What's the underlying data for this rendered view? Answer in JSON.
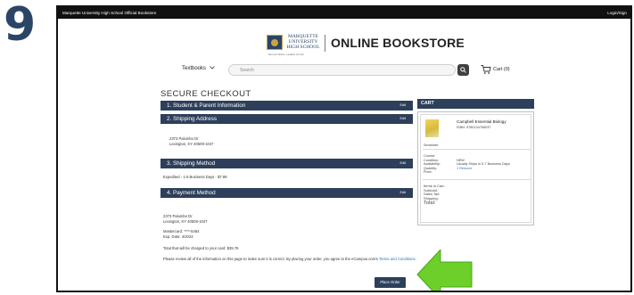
{
  "step_number": "9",
  "topbar": {
    "site_name": "Marquette University High School Official Bookstore",
    "login": "Login/Sign"
  },
  "brand": {
    "logo_line1": "MARQUETTE",
    "logo_line2": "UNIVERSITY",
    "logo_line3": "HIGH SCHOOL",
    "tagline": "Men for Others, Leaders for Life",
    "title": "ONLINE BOOKSTORE"
  },
  "nav": {
    "textbooks": "Textbooks",
    "search_placeholder": "Search",
    "cart": "Cart (0)"
  },
  "checkout": {
    "title": "SECURE CHECKOUT",
    "edit_label": "Edit",
    "sections": {
      "student": "1. Student & Parent Information",
      "shipping_address": "2. Shipping Address",
      "shipping_method": "3. Shipping Method",
      "payment": "4. Payment Method"
    },
    "address_line1": "2373 Palumbo Dr",
    "address_line2": "Lexington, KY 40509-1047",
    "shipping_method_value": "Expedited - 1-5 Business Days - $7.99",
    "billing_line1": "2373 Palumbo Dr",
    "billing_line2": "Lexington, KY 40509-1047",
    "card": "Mastercard: ****-5454",
    "exp": "Exp. Date: 4/2024",
    "total_charged": "Total that will be charged to your card: $35.76",
    "notice_part1": "Please review all of the information on this page to make sure it is correct. By placing your order, you agree to the",
    "notice_part2": "eCampus.com's",
    "terms_link": "Terms and Conditions",
    "place_order": "Place Order"
  },
  "cart": {
    "title": "CART",
    "book_title": "Campbell Essential Biology",
    "isbn": "ISBN: 9780134765037",
    "semester_label": "Semester:",
    "course_label": "Course:",
    "condition_label": "Condition:",
    "condition_value": "NEW",
    "availability_label": "Availability:",
    "availability_value": "Usually Ships in 5-7 Business Days",
    "quantity_label": "Quantity:",
    "quantity_value": "1 Remove",
    "price_label": "Price:",
    "items_label": "Items in Cart:",
    "subtotal_label": "Subtotal:",
    "tax_label": "Sales Tax:",
    "shipping_label": "Shipping:",
    "total_label": "Total:"
  }
}
